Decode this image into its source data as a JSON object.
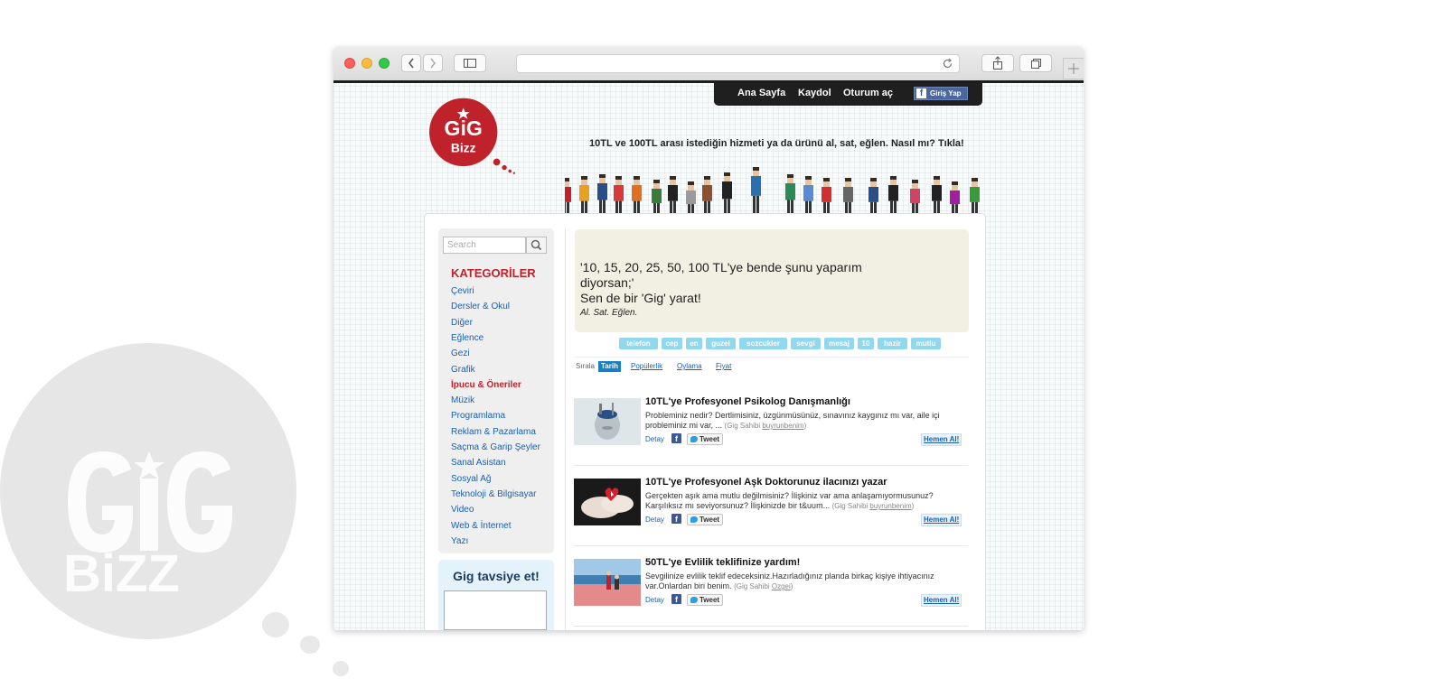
{
  "browser": {},
  "nav": {
    "home": "Ana Sayfa",
    "register": "Kaydol",
    "login": "Oturum aç",
    "facebook_login": "Giriş Yap"
  },
  "logo": {
    "line1": "GiG",
    "line2": "Bizz"
  },
  "tagline": "10TL ve 100TL arası istediğin hizmeti ya da ürünü al, sat, eğlen. Nasıl mı? Tıkla!",
  "sidebar": {
    "search_placeholder": "Search",
    "categories_title": "KATEGORİLER",
    "categories": [
      "Çeviri",
      "Dersler & Okul",
      "Diğer",
      "Eğlence",
      "Gezi",
      "Grafik",
      "İpucu & Öneriler",
      "Müzik",
      "Programlama",
      "Reklam & Pazarlama",
      "Saçma & Garip Şeyler",
      "Sanal Asistan",
      "Sosyal Ağ",
      "Teknoloji & Bilgisayar",
      "Video",
      "Web & İnternet",
      "Yazı"
    ],
    "active_category": "İpucu & Öneriler",
    "suggest_title": "Gig tavsiye et!"
  },
  "hero": {
    "line1": "'10, 15, 20, 25, 50, 100 TL'ye bende şunu yaparım",
    "line2": "diyorsan;'",
    "line3": "Sen de bir 'Gig' yarat!",
    "sub": "Al. Sat. Eğlen."
  },
  "tags": [
    "telefon",
    "cep",
    "en",
    "guzel",
    "sozcukler",
    "sevgi",
    "mesaj",
    "10",
    "hazir",
    "mutlu"
  ],
  "sort": {
    "label": "Sırala",
    "options": [
      "Tarih",
      "Popülerlik",
      "Oylama",
      "Fiyat"
    ],
    "active": "Tarih"
  },
  "gigs": [
    {
      "title": "10TL'ye Profesyonel Psikolog Danışmanlığı",
      "desc": "Probleminiz nedir? Dertlimisiniz, üzgünmüsünüz, sınavınız kaygınız mı var, aile içi probleminiz mi var, ...",
      "owner_prefix": "(Gig Sahibi ",
      "owner": "buyrunbenim",
      "owner_suffix": ")",
      "detail": "Detay",
      "tweet": "Tweet",
      "buy": "Hemen Al!"
    },
    {
      "title": "10TL'ye Profesyonel Aşk Doktorunuz ilacınızı yazar",
      "desc": "Gerçekten aşık ama mutlu değilmisiniz? İlişkiniz var ama anlaşamıyormusunuz? Karşılıksız mı seviyorsunuz? İlişkinizde bir t&uum...",
      "owner_prefix": "(Gig Sahibi ",
      "owner": "buyrunbenim",
      "owner_suffix": ")",
      "detail": "Detay",
      "tweet": "Tweet",
      "buy": "Hemen Al!"
    },
    {
      "title": "50TL'ye Evlilik teklifinize yardım!",
      "desc": "Sevgilinize evlilik teklif edeceksiniz.Hazırladığınız planda birkaç kişiye ihtiyacınız var.Onlardan biri benim.",
      "owner_prefix": "(Gig Sahibi ",
      "owner": "Ozgei",
      "owner_suffix": ")",
      "detail": "Detay",
      "tweet": "Tweet",
      "buy": "Hemen Al!"
    }
  ],
  "colors": {
    "brand_red": "#c0222c",
    "link_blue": "#1a5fb4",
    "tag_blue": "#8fd8ee",
    "nav_dark": "#1f1f1f"
  }
}
